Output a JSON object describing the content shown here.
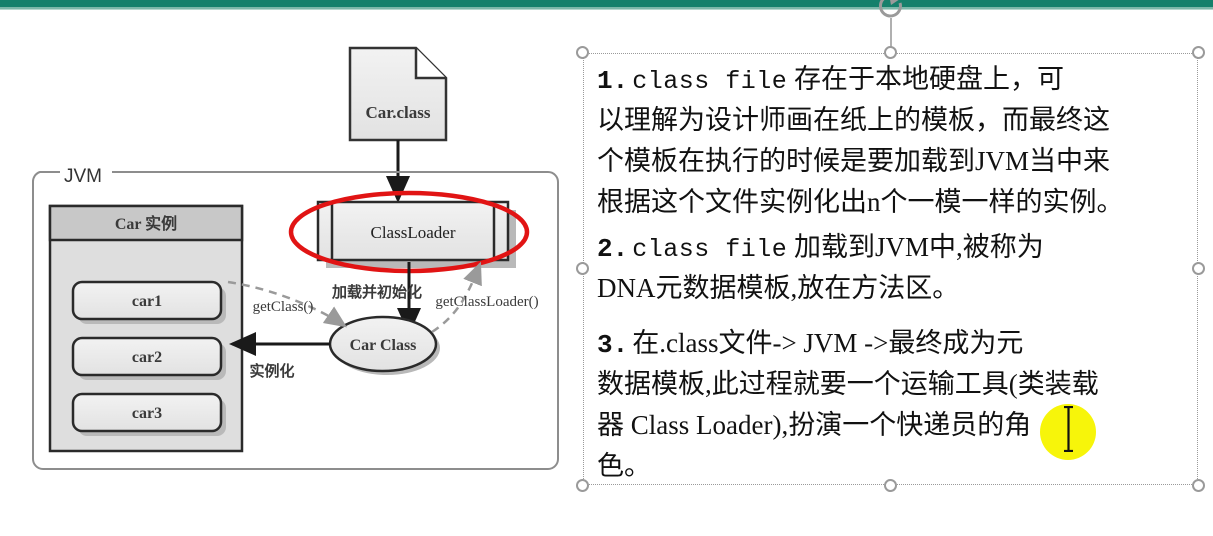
{
  "window": {
    "accent_color": "#15806b",
    "background": "#ffffff"
  },
  "diagram": {
    "name": "jvm-classloader-diagram",
    "class_file_node": "Car.class",
    "jvm_label": "JVM",
    "instances_header": "Car 实例",
    "instances": [
      "car1",
      "car2",
      "car3"
    ],
    "classloader_node": "ClassLoader",
    "car_class_node": "Car Class",
    "edge_labels": {
      "load_init": "加载并初始化",
      "get_class": "getClass()",
      "get_classloader": "getClassLoader()",
      "instantiate": "实例化"
    },
    "annotation": {
      "shape": "ellipse",
      "color": "#e11414",
      "target": "ClassLoader"
    }
  },
  "textbox": {
    "selected": true,
    "paragraphs": [
      {
        "number": "1.",
        "lines": [
          {
            "mono": "class file",
            "cjk": " 存在于本地硬盘上，可"
          },
          {
            "mono": "",
            "cjk": "以理解为设计师画在纸上的模板，而最终这"
          },
          {
            "mono": "",
            "cjk": "个模板在执行的时候是要加载到JVM当中来"
          },
          {
            "mono": "",
            "cjk": "根据这个文件实例化出n个一模一样的实例。"
          }
        ]
      },
      {
        "number": "2.",
        "lines": [
          {
            "mono": "class file",
            "cjk": " 加载到JVM中,被称为"
          },
          {
            "mono": "",
            "cjk": "DNA元数据模板,放在方法区。"
          }
        ]
      },
      {
        "number": "3.",
        "lines": [
          {
            "mono": "",
            "cjk": "在.class文件-> JVM ->最终成为元"
          },
          {
            "mono": "",
            "cjk": "数据模板,此过程就要一个运输工具(类装载"
          },
          {
            "mono": "",
            "cjk": "器 Class Loader),扮演一个快递员的角"
          },
          {
            "mono": "",
            "cjk": "色。"
          }
        ]
      }
    ]
  },
  "cursor": {
    "type": "i-beam",
    "highlight_color": "#f7f50a"
  }
}
